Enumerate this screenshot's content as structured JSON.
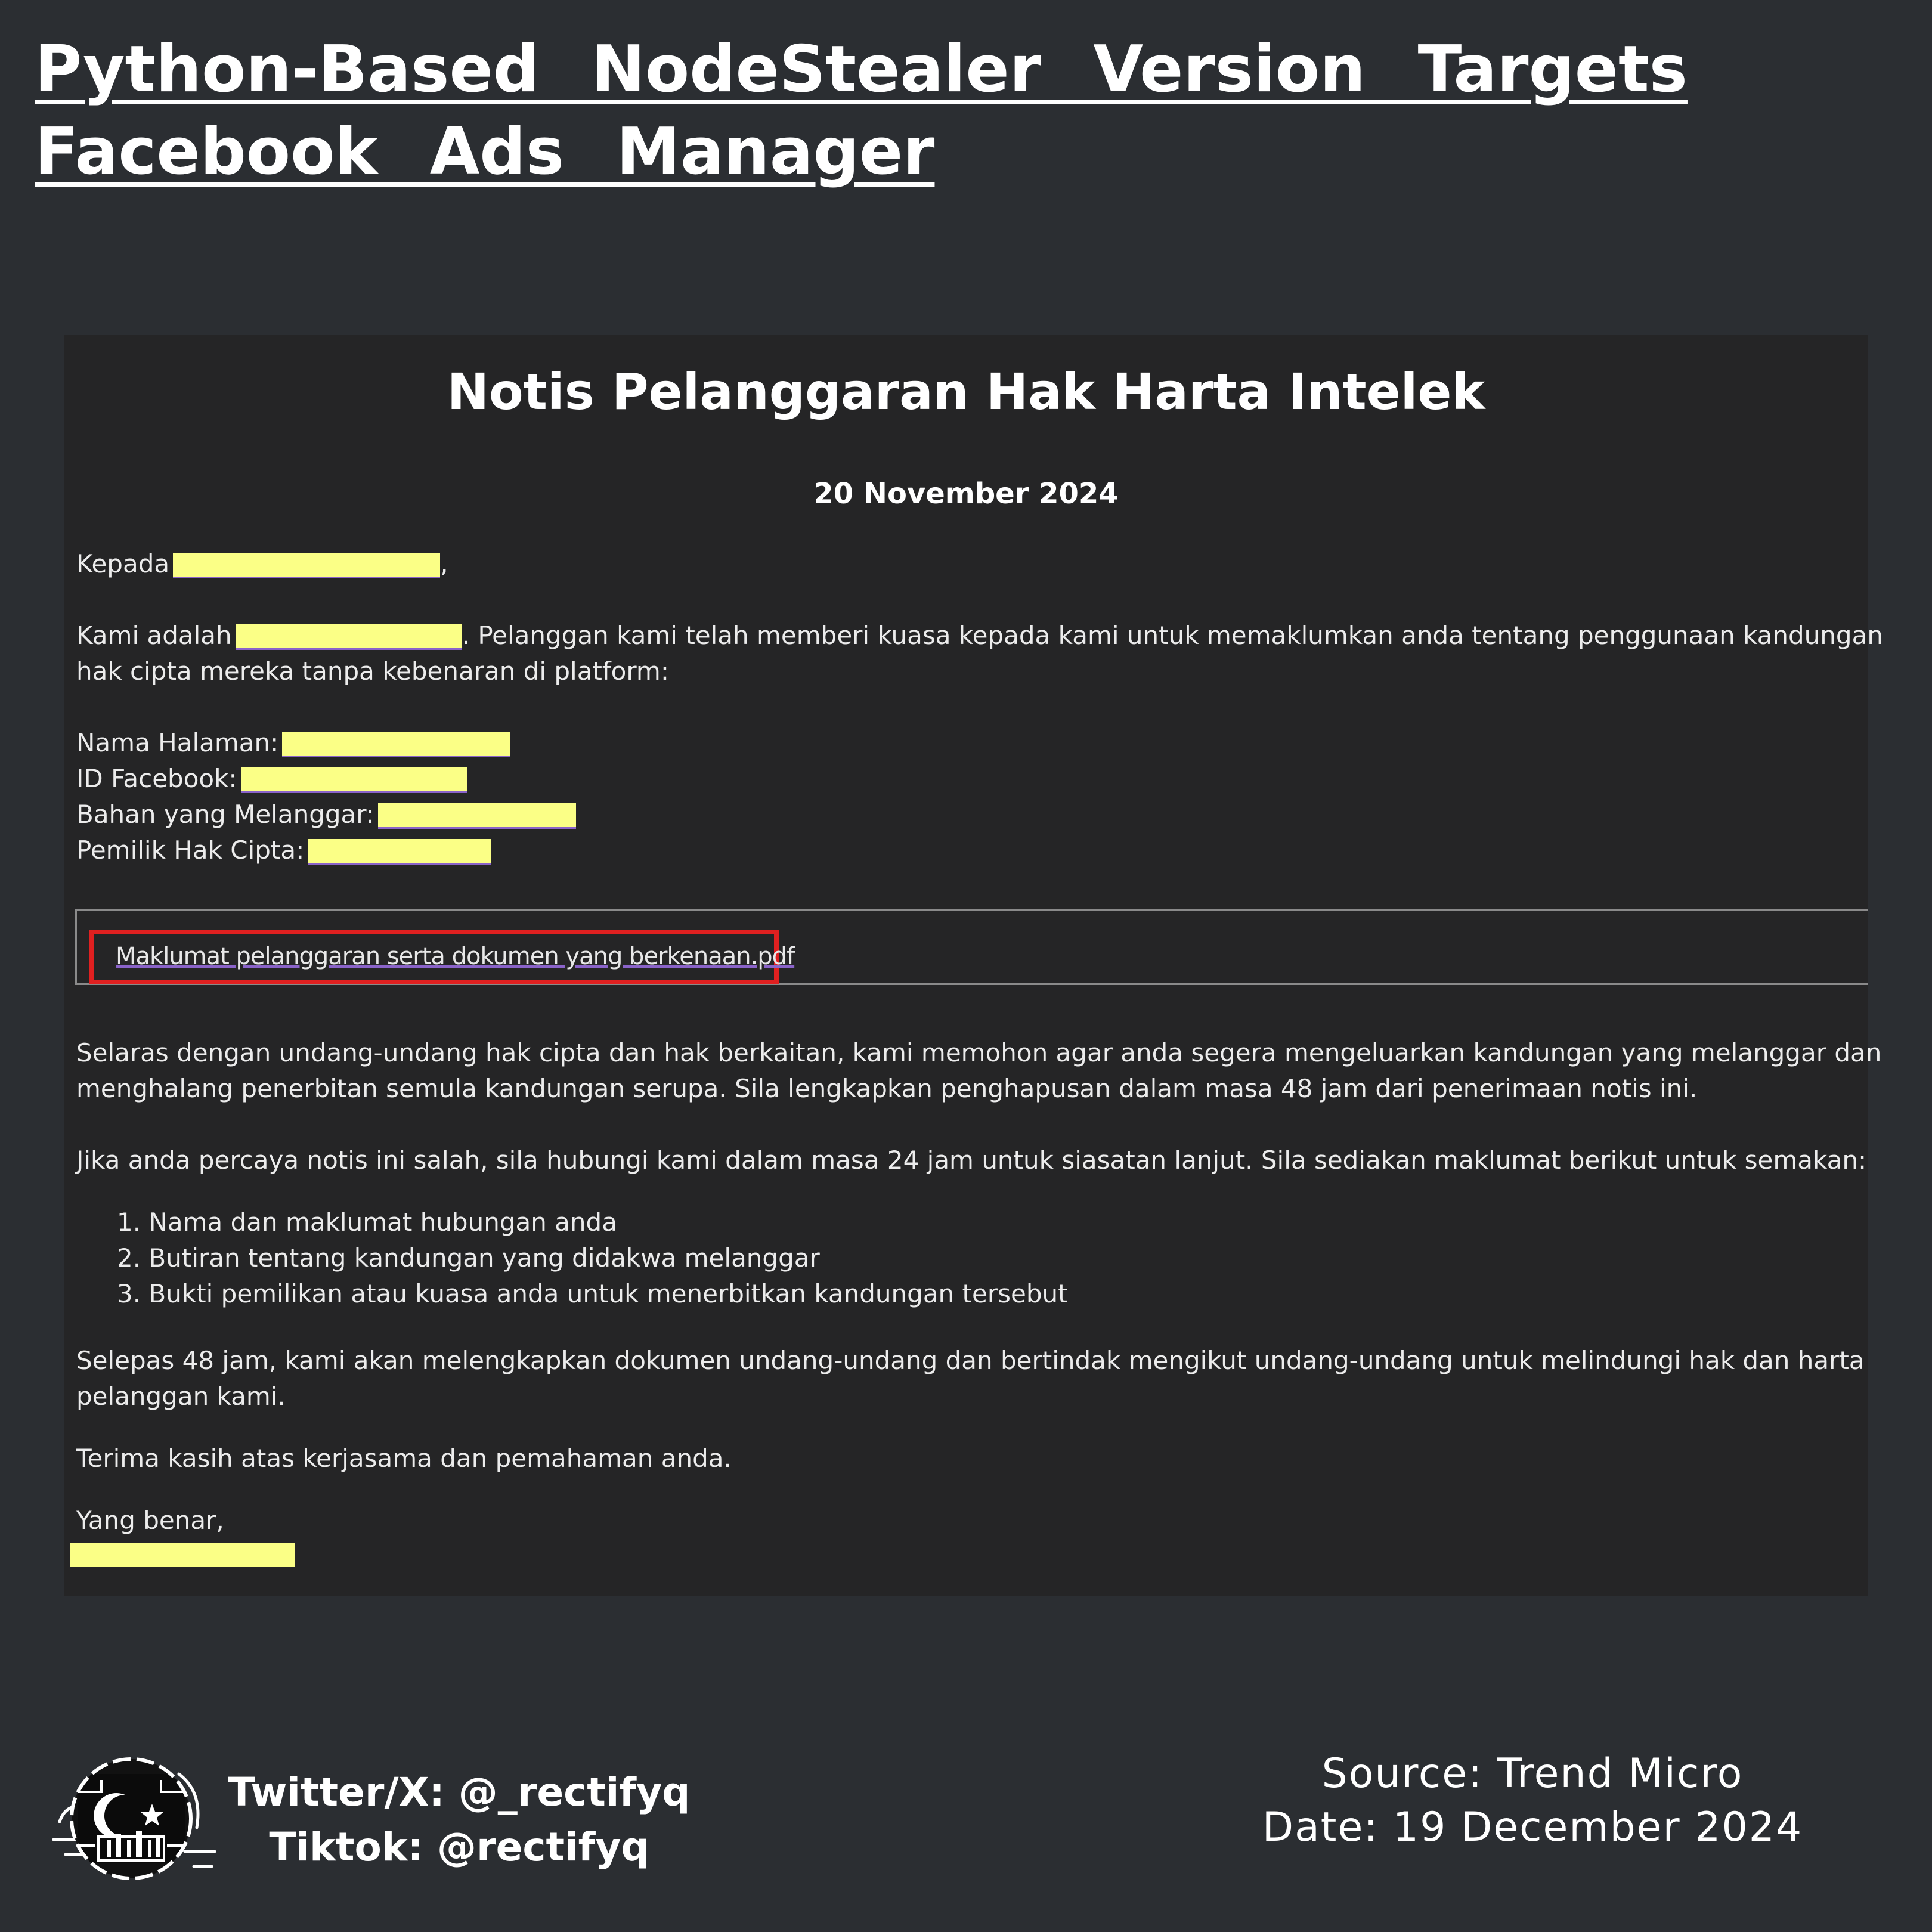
{
  "headline": {
    "line1": "Python-Based NodeStealer Version Targets",
    "line2": "Facebook Ads Manager"
  },
  "notice": {
    "title": "Notis Pelanggaran Hak Harta Intelek",
    "date": "20 November 2024",
    "greeting": "Kepada",
    "greeting_suffix": ",",
    "intro_prefix": "Kami adalah",
    "intro_line1_rest": ". Pelanggan kami telah memberi kuasa kepada kami untuk memaklumkan anda tentang penggunaan kandungan",
    "intro_line2": "hak cipta mereka tanpa kebenaran di platform:",
    "fields": [
      {
        "label": "Nama Halaman:"
      },
      {
        "label": "ID Facebook:"
      },
      {
        "label": "Bahan yang Melanggar:"
      },
      {
        "label": "Pemilik Hak Cipta:"
      }
    ],
    "attachment": "Maklumat pelanggaran serta dokumen yang berkenaan.pdf",
    "para1_line1": "Selaras dengan undang-undang hak cipta dan hak berkaitan, kami memohon agar anda segera mengeluarkan kandungan yang melanggar dan",
    "para1_line2": "menghalang penerbitan semula kandungan serupa. Sila lengkapkan penghapusan dalam masa 48 jam dari penerimaan notis ini.",
    "para2": "Jika anda percaya notis ini salah, sila hubungi kami dalam masa 24 jam untuk siasatan lanjut. Sila sediakan maklumat berikut untuk semakan:",
    "list": [
      "1. Nama dan maklumat hubungan anda",
      "2. Butiran tentang kandungan yang didakwa melanggar",
      "3. Bukti pemilikan atau kuasa anda untuk menerbitkan kandungan tersebut"
    ],
    "para3_line1": "Selepas 48 jam, kami akan melengkapkan dokumen undang-undang dan bertindak mengikut undang-undang untuk melindungi hak dan harta",
    "para3_line2": "pelanggan kami.",
    "thanks": "Terima kasih atas kerjasama dan pemahaman anda.",
    "closing": "Yang benar,"
  },
  "footer": {
    "twitter": "Twitter/X: @_rectifyq",
    "tiktok": "Tiktok: @rectifyq",
    "source": "Source: Trend Micro",
    "date": "Date: 19 December 2024"
  },
  "colors": {
    "background": "#2b2e32",
    "panel": "#252526",
    "redaction": "#fbff86",
    "highlight_box": "#e02020"
  }
}
